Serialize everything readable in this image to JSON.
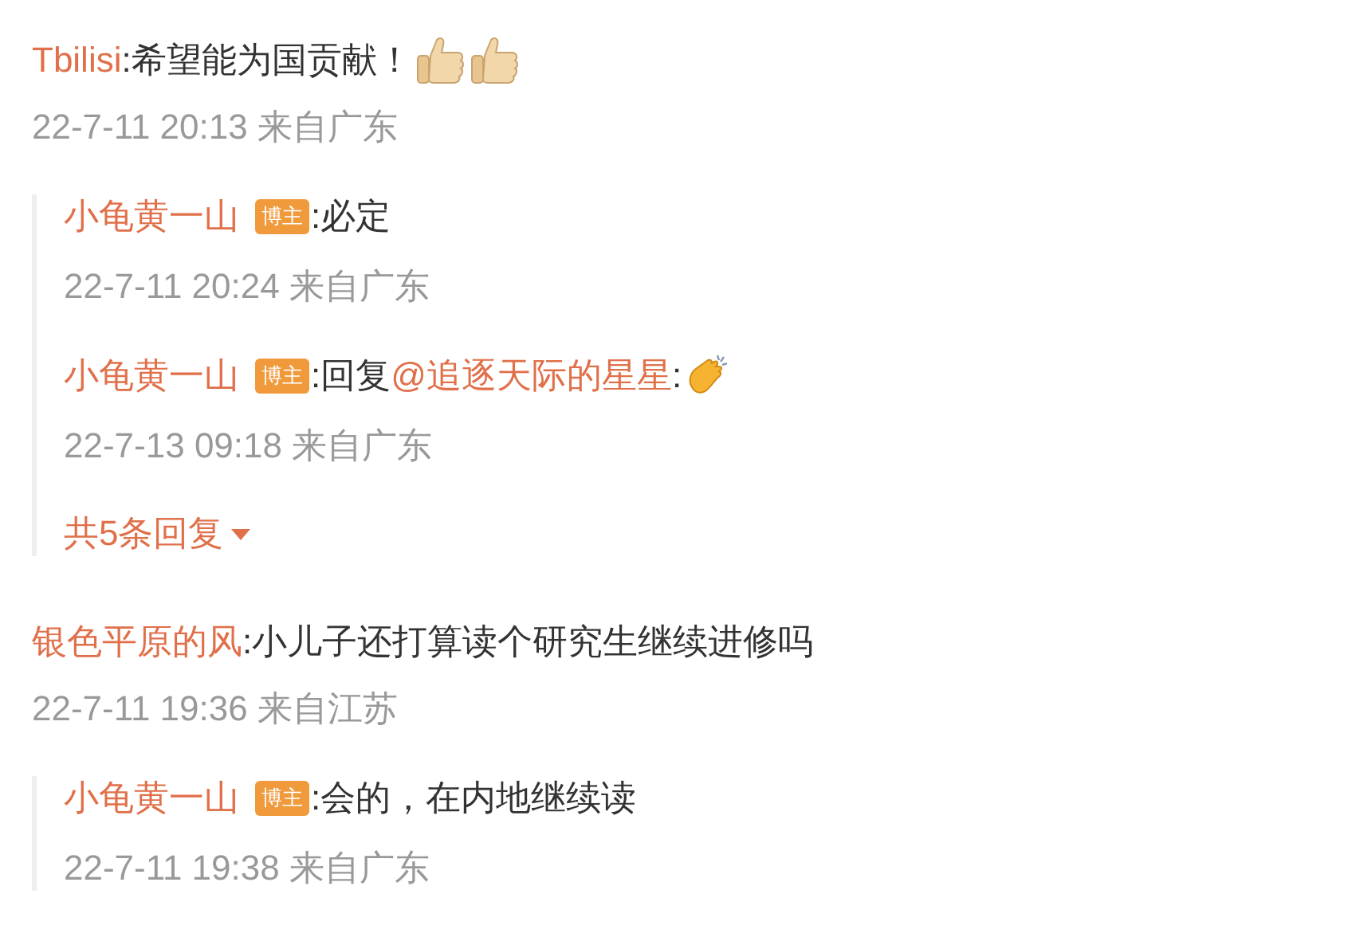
{
  "comments": [
    {
      "author": "Tbilisi",
      "parts": [
        {
          "kind": "text",
          "text": ":希望能为国贡献！"
        },
        {
          "kind": "thumbs"
        },
        {
          "kind": "thumbs"
        }
      ],
      "time": "22-7-11 20:13 来自广东",
      "replies": [
        {
          "author": "小龟黄一山",
          "badge": "博主",
          "parts": [
            {
              "kind": "text",
              "text": ":必定"
            }
          ],
          "time": "22-7-11 20:24 来自广东"
        },
        {
          "author": "小龟黄一山",
          "badge": "博主",
          "parts": [
            {
              "kind": "text",
              "text": ":回复"
            },
            {
              "kind": "mention",
              "text": "@追逐天际的星星"
            },
            {
              "kind": "text",
              "text": ":"
            },
            {
              "kind": "clap"
            }
          ],
          "time": "22-7-13 09:18 来自广东"
        }
      ],
      "more": "共5条回复"
    },
    {
      "author": "银色平原的风",
      "parts": [
        {
          "kind": "text",
          "text": ":小儿子还打算读个研究生继续进修吗"
        }
      ],
      "time": "22-7-11 19:36 来自江苏",
      "replies": [
        {
          "author": "小龟黄一山",
          "badge": "博主",
          "parts": [
            {
              "kind": "text",
              "text": ":会的，在内地继续读"
            }
          ],
          "time": "22-7-11 19:38 来自广东"
        }
      ]
    }
  ]
}
